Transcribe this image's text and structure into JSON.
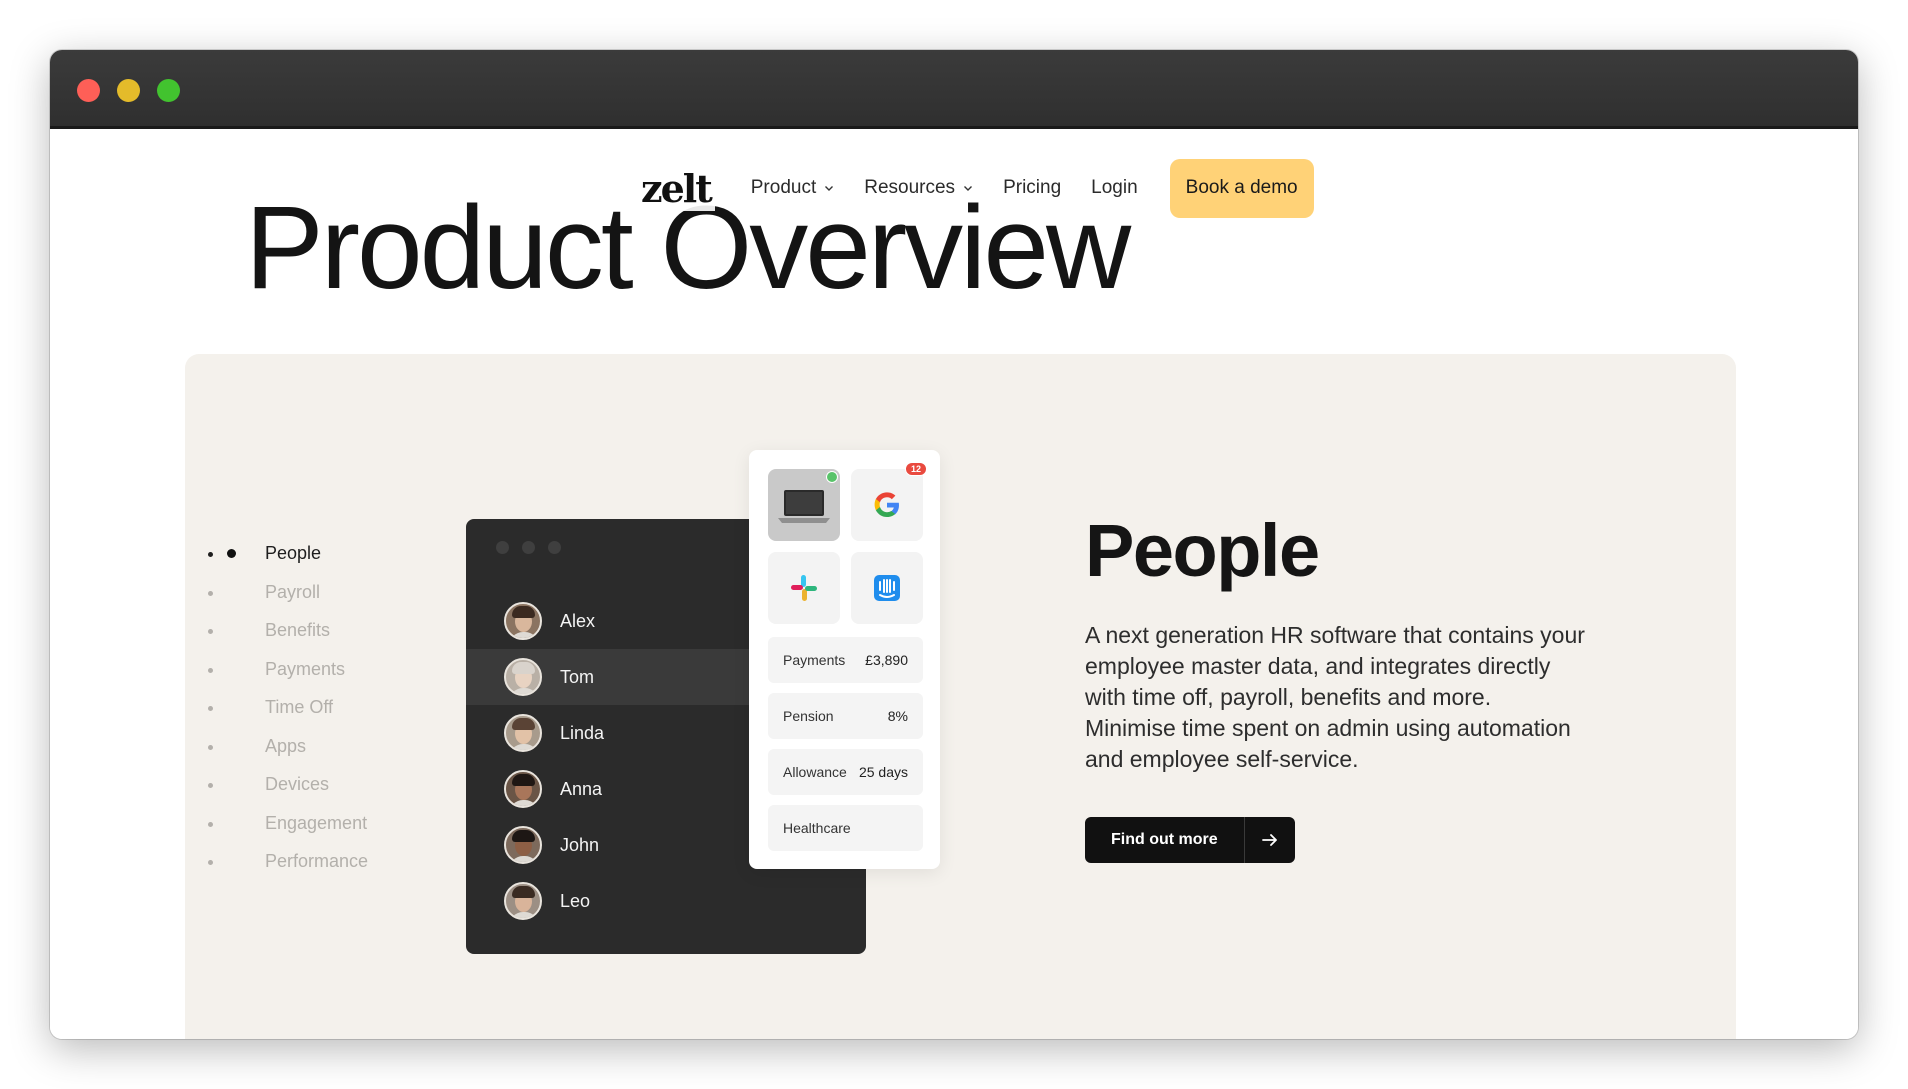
{
  "window": {
    "controls": [
      "close",
      "minimize",
      "maximize"
    ]
  },
  "nav": {
    "logo": "zelt",
    "items": [
      {
        "label": "Product",
        "has_dropdown": true
      },
      {
        "label": "Resources",
        "has_dropdown": true
      },
      {
        "label": "Pricing",
        "has_dropdown": false
      },
      {
        "label": "Login",
        "has_dropdown": false
      }
    ],
    "cta": "Book a demo"
  },
  "hero": {
    "title": "Product Overview"
  },
  "sidenav": {
    "items": [
      "People",
      "Payroll",
      "Benefits",
      "Payments",
      "Time Off",
      "Apps",
      "Devices",
      "Engagement",
      "Performance"
    ],
    "active": "People"
  },
  "illustration": {
    "people": [
      "Alex",
      "Tom",
      "Linda",
      "Anna",
      "John",
      "Leo"
    ],
    "selected_person": "Tom",
    "app_tiles": [
      {
        "icon": "laptop-icon"
      },
      {
        "icon": "google-icon",
        "badge": "12"
      },
      {
        "icon": "slack-icon"
      },
      {
        "icon": "intercom-icon"
      }
    ],
    "rows": [
      {
        "label": "Payments",
        "value": "£3,890"
      },
      {
        "label": "Pension",
        "value": "8%"
      },
      {
        "label": "Allowance",
        "value": "25 days"
      },
      {
        "label": "Healthcare",
        "value": ""
      }
    ]
  },
  "section": {
    "title": "People",
    "description": "A next generation HR software that contains your employee master data, and integrates directly with time off, payroll, benefits and more. Minimise time spent on admin using automation and employee self-service.",
    "cta": "Find out more"
  },
  "colors": {
    "accent": "#ffd277",
    "panel_bg": "#f4f1ec",
    "dark_card": "#2b2b2b"
  }
}
